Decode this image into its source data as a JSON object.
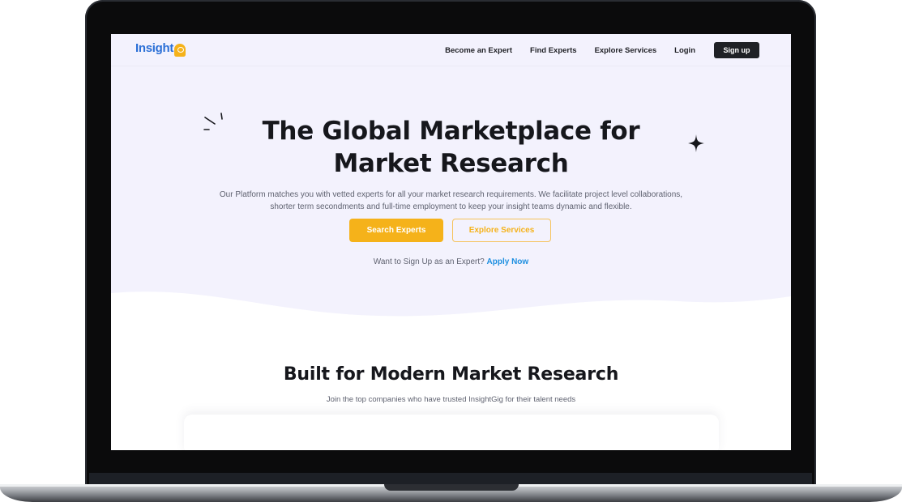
{
  "nav": {
    "logo_text": "Insight",
    "links": [
      "Become an Expert",
      "Find Experts",
      "Explore Services",
      "Login"
    ],
    "signup_label": "Sign up"
  },
  "hero": {
    "title_line1": "The Global Marketplace for",
    "title_line2": "Market Research",
    "description": "Our Platform matches you with vetted experts for all your market research requirements. We facilitate project level collaborations, shorter term secondments and full-time employment to keep your insight teams dynamic and flexible.",
    "primary_button": "Search Experts",
    "secondary_button": "Explore Services",
    "signup_prompt": "Want to Sign Up as an Expert?",
    "signup_link": "Apply Now"
  },
  "section2": {
    "title": "Built for Modern Market Research",
    "subtitle": "Join the top companies who have trusted InsightGig for their talent needs"
  },
  "colors": {
    "hero_background": "#f3f2fd",
    "accent": "#f5b21a",
    "logo_blue": "#2a6fd6",
    "link_blue": "#1d8fe0",
    "dark": "#1f2126"
  },
  "icons": {
    "logo_badge": "insightgig-badge-icon",
    "sparkle_lines": "sparkle-lines-icon",
    "star": "four-point-star-icon"
  }
}
